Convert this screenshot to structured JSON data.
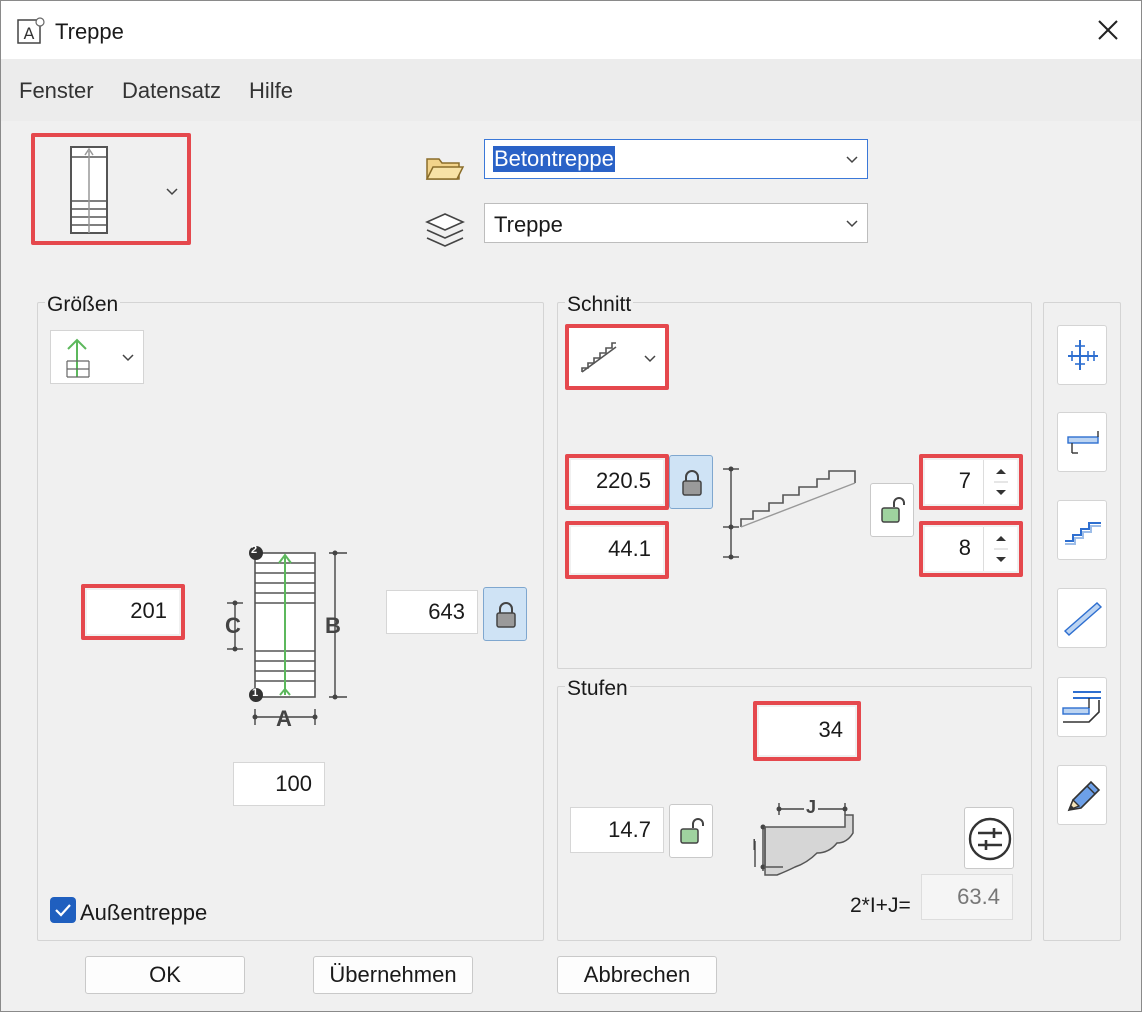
{
  "window": {
    "title": "Treppe"
  },
  "menu": {
    "items": [
      "Fenster",
      "Datensatz",
      "Hilfe"
    ]
  },
  "header": {
    "material_combo": {
      "value": "Betontreppe"
    },
    "layer_combo": {
      "value": "Treppe"
    }
  },
  "groessen": {
    "label": "Größen",
    "length_field": "201",
    "height_field": "643",
    "width_field": "100",
    "outdoor_checkbox": {
      "label": "Außentreppe",
      "checked": true
    },
    "diagram": {
      "label_a": "A",
      "label_b": "B",
      "label_c": "C",
      "marker_1": "1",
      "marker_2": "2"
    }
  },
  "schnitt": {
    "label": "Schnitt",
    "height_field": "220.5",
    "offset_field": "44.1",
    "upper_spinner": "7",
    "lower_spinner": "8"
  },
  "stufen": {
    "label": "Stufen",
    "count_field": "34",
    "rise_field": "14.7",
    "formula_label": "2*I+J=",
    "formula_value": "63.4",
    "diagram_label_j": "J",
    "diagram_label_i": "I"
  },
  "buttons": {
    "ok": "OK",
    "apply": "Übernehmen",
    "cancel": "Abbrechen"
  },
  "colors": {
    "highlight": "#e5484d",
    "lock_active": "#cfe3f5",
    "checkbox": "#1f5fbf",
    "accent_green": "#5cb85c",
    "tool_blue": "#2e6fd0"
  }
}
